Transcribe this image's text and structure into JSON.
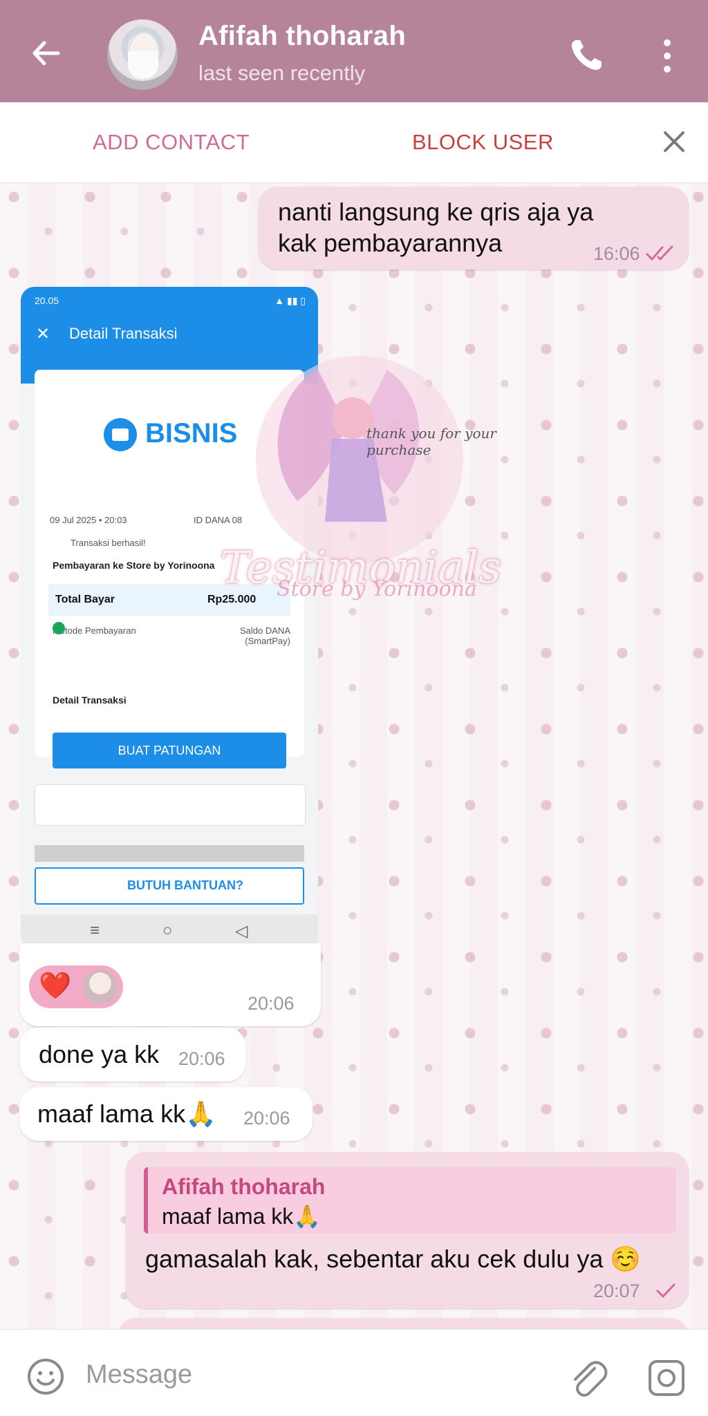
{
  "header": {
    "title": "Afifah thoharah",
    "subtitle": "last seen recently"
  },
  "actions": {
    "add_contact": "ADD CONTACT",
    "block_user": "BLOCK USER"
  },
  "messages": [
    {
      "text": "nanti langsung ke qris aja ya kak pembayarannya",
      "time": "16:06",
      "outgoing": true
    },
    {
      "text": "done ya kk",
      "time": "20:06",
      "outgoing": false
    },
    {
      "text": "maaf lama kk🙏",
      "time": "20:06",
      "outgoing": false
    },
    {
      "text": "gamasalah kak, sebentar aku cek dulu ya ☺️",
      "time": "20:07",
      "outgoing": true
    }
  ],
  "image_message": {
    "time": "20:06",
    "reaction": "❤️"
  },
  "reply": {
    "name": "Afifah thoharah",
    "text": "maaf lama kk🙏"
  },
  "screenshot": {
    "status_time": "20.05",
    "title": "Detail Transaksi",
    "logo_text": "BISNIS",
    "date": "09 Jul 2025 • 20:03",
    "id_label": "ID DANA 08",
    "success": "Transaksi berhasil!",
    "payment_to": "Pembayaran ke Store by Yorinoona",
    "total_label": "Total Bayar",
    "total_value": "Rp25.000",
    "method_label": "Metode Pembayaran",
    "method_value": "Saldo DANA (SmartPay)",
    "detail_label": "Detail Transaksi",
    "button": "BUAT PATUNGAN",
    "help": "BUTUH BANTUAN?"
  },
  "overlay": {
    "title": "Testimonials",
    "subtitle": "Store by Yorinoona",
    "note": "thank you for your purchase"
  },
  "input": {
    "placeholder": "Message"
  }
}
